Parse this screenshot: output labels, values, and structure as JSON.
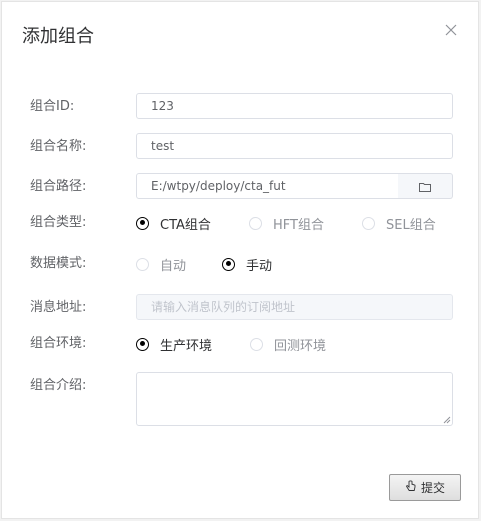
{
  "dialog": {
    "title": "添加组合"
  },
  "fields": {
    "id_label": "组合ID:",
    "id_value": "123",
    "name_label": "组合名称:",
    "name_value": "test",
    "path_label": "组合路径:",
    "path_value": "E:/wtpy/deploy/cta_fut",
    "type_label": "组合类型:",
    "type_options": [
      {
        "label": "CTA组合",
        "checked": true
      },
      {
        "label": "HFT组合",
        "checked": false
      },
      {
        "label": "SEL组合",
        "checked": false
      }
    ],
    "mode_label": "数据模式:",
    "mode_options": [
      {
        "label": "自动",
        "checked": false
      },
      {
        "label": "手动",
        "checked": true
      }
    ],
    "mq_label": "消息地址:",
    "mq_placeholder": "请输入消息队列的订阅地址",
    "env_label": "组合环境:",
    "env_options": [
      {
        "label": "生产环境",
        "checked": true
      },
      {
        "label": "回测环境",
        "checked": false
      }
    ],
    "desc_label": "组合介绍:"
  },
  "footer": {
    "submit_label": "提交"
  },
  "icons": {
    "close": "close-icon",
    "folder": "folder-icon",
    "submit": "hand-pointer-icon"
  }
}
